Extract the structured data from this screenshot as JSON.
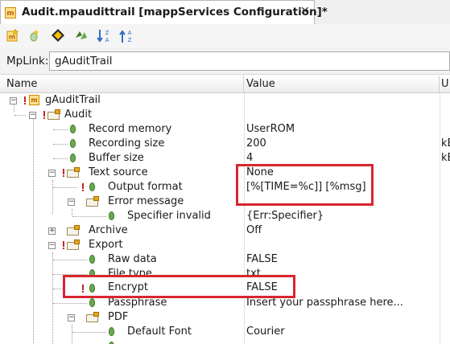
{
  "tab": {
    "title": "Audit.mpaudittrail [mappServices Configuration]*",
    "close_glyph": "✕",
    "icon_letter": "m"
  },
  "toolbar": {
    "icons": [
      "new-config-icon",
      "insert-icon",
      "navigate-icon",
      "sync-icon",
      "sort-descending-icon",
      "sort-ascending-icon"
    ]
  },
  "mplink": {
    "label": "MpLink:",
    "value": "gAuditTrail"
  },
  "columns": {
    "name": "Name",
    "value": "Value",
    "unit": "U"
  },
  "tree": {
    "root": {
      "name": "gAuditTrail"
    },
    "audit": {
      "name": "Audit"
    },
    "record_memory": {
      "name": "Record memory",
      "value": "UserROM"
    },
    "recording_size": {
      "name": "Recording size",
      "value": "200",
      "unit": "kB"
    },
    "buffer_size": {
      "name": "Buffer size",
      "value": "4",
      "unit": "kB"
    },
    "text_source": {
      "name": "Text source",
      "value": "None"
    },
    "output_format": {
      "name": "Output format",
      "value": "[%[TIME=%c]] [%msg]"
    },
    "error_message": {
      "name": "Error message"
    },
    "specifier_invalid": {
      "name": "Specifier invalid",
      "value": "{Err:Specifier}"
    },
    "archive": {
      "name": "Archive",
      "value": "Off"
    },
    "export": {
      "name": "Export"
    },
    "raw_data": {
      "name": "Raw data",
      "value": "FALSE"
    },
    "file_type": {
      "name": "File type",
      "value": "txt"
    },
    "encrypt": {
      "name": "Encrypt",
      "value": "FALSE"
    },
    "passphrase": {
      "name": "Passphrase",
      "value": "Insert your passphrase here..."
    },
    "pdf": {
      "name": "PDF"
    },
    "default_font": {
      "name": "Default Font",
      "value": "Courier"
    }
  },
  "colors": {
    "highlight": "#d9262e",
    "parameter_leaf": "#6aa84f",
    "modified_marker": "#c0282a",
    "folder": "#e6a51a"
  }
}
